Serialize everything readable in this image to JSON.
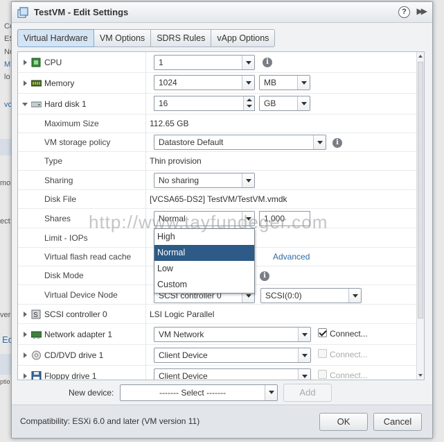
{
  "background": {
    "fragments": [
      "Co",
      "ESX",
      "No",
      "M",
      "lo",
      "vo",
      "mo",
      "ect",
      "ver",
      "Ec",
      "ptio"
    ]
  },
  "dialog": {
    "title": "TestVM - Edit Settings",
    "help_icon": "?",
    "tabs": [
      {
        "label": "Virtual Hardware",
        "active": true
      },
      {
        "label": "VM Options",
        "active": false
      },
      {
        "label": "SDRS Rules",
        "active": false
      },
      {
        "label": "vApp Options",
        "active": false
      }
    ]
  },
  "hardware": {
    "cpu": {
      "label": "CPU",
      "value": "1"
    },
    "memory": {
      "label": "Memory",
      "value": "1024",
      "unit": "MB"
    },
    "hard_disk": {
      "label": "Hard disk 1",
      "value": "16",
      "unit": "GB",
      "max_size_label": "Maximum Size",
      "max_size": "112.65 GB",
      "storage_policy_label": "VM storage policy",
      "storage_policy": "Datastore Default",
      "type_label": "Type",
      "type": "Thin provision",
      "sharing_label": "Sharing",
      "sharing": "No sharing",
      "disk_file_label": "Disk File",
      "disk_file": "[VCSA65-DS2] TestVM/TestVM.vmdk",
      "shares_label": "Shares",
      "shares": "Normal",
      "shares_value": "1,000",
      "limit_label": "Limit - IOPs",
      "flash_label": "Virtual flash read cache",
      "flash_link": "Advanced",
      "disk_mode_label": "Disk Mode",
      "vdn_label": "Virtual Device Node",
      "vdn_controller": "SCSI controller 0",
      "vdn_slot": "SCSI(0:0)"
    },
    "scsi": {
      "label": "SCSI controller 0",
      "value": "LSI Logic Parallel"
    },
    "network": {
      "label": "Network adapter 1",
      "value": "VM Network",
      "connect": "Connect..."
    },
    "cdrom": {
      "label": "CD/DVD drive 1",
      "value": "Client Device",
      "connect": "Connect..."
    },
    "floppy": {
      "label": "Floppy drive 1",
      "value": "Client Device",
      "connect": "Connect..."
    }
  },
  "shares_dropdown": {
    "options": [
      "High",
      "Normal",
      "Low",
      "Custom"
    ],
    "selected": "Normal"
  },
  "new_device": {
    "label": "New device:",
    "select": "------- Select -------",
    "add": "Add"
  },
  "footer": {
    "compatibility": "Compatibility: ESXi 6.0 and later (VM version 11)",
    "ok": "OK",
    "cancel": "Cancel"
  },
  "watermark": "http://www.tayfundeger.com"
}
